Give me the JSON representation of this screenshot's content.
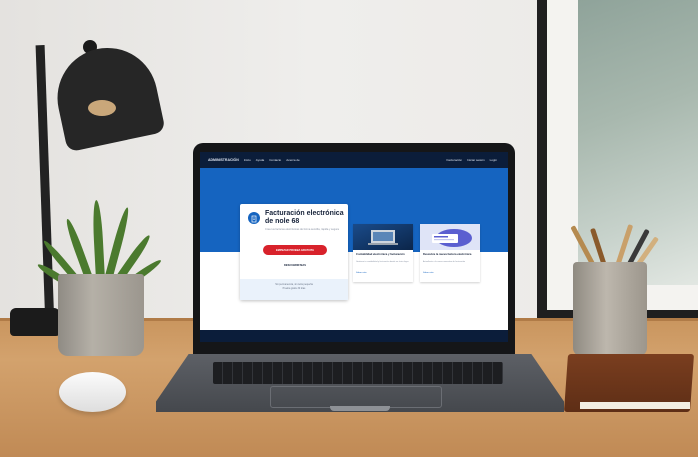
{
  "screen": {
    "nav": {
      "logo": "ADMINISTRACIÓN",
      "links": [
        "Inicio",
        "Ayuda",
        "Contacto",
        "Acerca de"
      ],
      "right_links": [
        "Facturación",
        "Iniciar sesión",
        "Login"
      ]
    },
    "card": {
      "title": "Facturación electrónica de nole 68",
      "description": "Crea tus facturas electrónicas de forma sencilla, rápida y segura",
      "primary_button": "EMPEZAR PRUEBA GRATUITA",
      "secondary_button": "DESCUBRIR MAS",
      "footer_line1": "Sin permanencia, sin letra pequeña",
      "footer_line2": "Prueba gratis 30 días"
    },
    "tiles": [
      {
        "title": "Contabilidad electrónica y facturación",
        "description": "Gestiona tu contabilidad y facturación desde un único lugar",
        "link": "Saber más"
      },
      {
        "title": "Descubre la nueva factura electrónica",
        "description": "Actualízate a la nueva normativa de facturación",
        "link": "Saber más"
      }
    ]
  },
  "colors": {
    "nav": "#0b1d3a",
    "hero": "#1564c0",
    "accent_red": "#d8222b",
    "card_footer": "#eaf2fb"
  },
  "icons": [
    "document-icon"
  ]
}
